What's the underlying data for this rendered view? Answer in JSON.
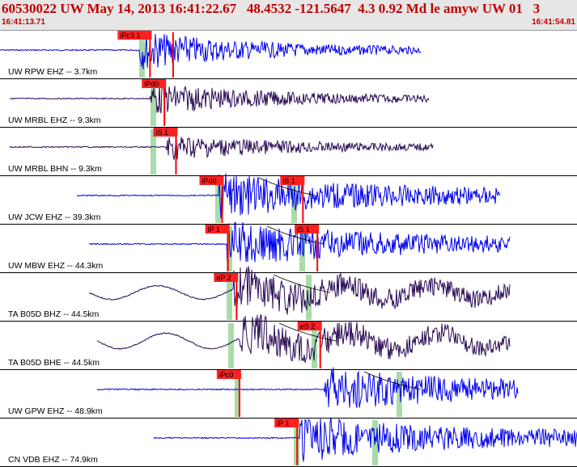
{
  "header": {
    "title": "60530022 UW May 14, 2013 16:41:22.67   48.4532 -121.5647  4.3 0.92 Md le amyw UW 01   3",
    "time_start": "16:41:13.71",
    "time_end": "16:41:54.81"
  },
  "colors": {
    "header_bg": "#e6e6e6",
    "title": "#c00000",
    "trace_blue": "#0000ee",
    "trace_purple": "#2a0b55",
    "pick": "#ff0000",
    "pick_label_bg": "#ff2020",
    "theory_band": "#a8dca8",
    "curve": "#000000"
  },
  "channels": [
    {
      "label": "UW RPW EHZ -- 3.7km",
      "color": "blue",
      "picks": [
        {
          "label": "iPc3 1",
          "time": 0.26
        },
        {
          "label": "",
          "time": 0.3
        }
      ]
    },
    {
      "label": "UW MRBL EHZ -- 9.3km",
      "color": "purple",
      "picks": [
        {
          "label": "iPd0",
          "time": 0.285
        }
      ]
    },
    {
      "label": "UW MRBL BHN -- 9.3km",
      "color": "purple",
      "picks": [
        {
          "label": "iS 1",
          "time": 0.305
        }
      ]
    },
    {
      "label": "UW JCW EHZ -- 39.3km",
      "color": "blue",
      "picks": [
        {
          "label": "iPd0",
          "time": 0.385
        },
        {
          "label": "iS 1",
          "time": 0.525
        }
      ]
    },
    {
      "label": "UW MBW EHZ -- 44.3km",
      "color": "blue",
      "picks": [
        {
          "label": "iP 1",
          "time": 0.395
        },
        {
          "label": "iS 1",
          "time": 0.55
        }
      ]
    },
    {
      "label": "TA B05D BHZ -- 44.5km",
      "color": "purple",
      "picks": [
        {
          "label": "eP 2",
          "time": 0.41
        }
      ]
    },
    {
      "label": "TA B05D BHE -- 44.5km",
      "color": "purple",
      "picks": [
        {
          "label": "eS 2",
          "time": 0.555
        }
      ]
    },
    {
      "label": "UW GPW EHZ -- 48.9km",
      "color": "blue",
      "picks": [
        {
          "label": "iPc0",
          "time": 0.415
        }
      ]
    },
    {
      "label": "CN VDB EHZ -- 74.9km",
      "color": "blue",
      "picks": [
        {
          "label": "iP 1",
          "time": 0.515
        }
      ]
    }
  ]
}
